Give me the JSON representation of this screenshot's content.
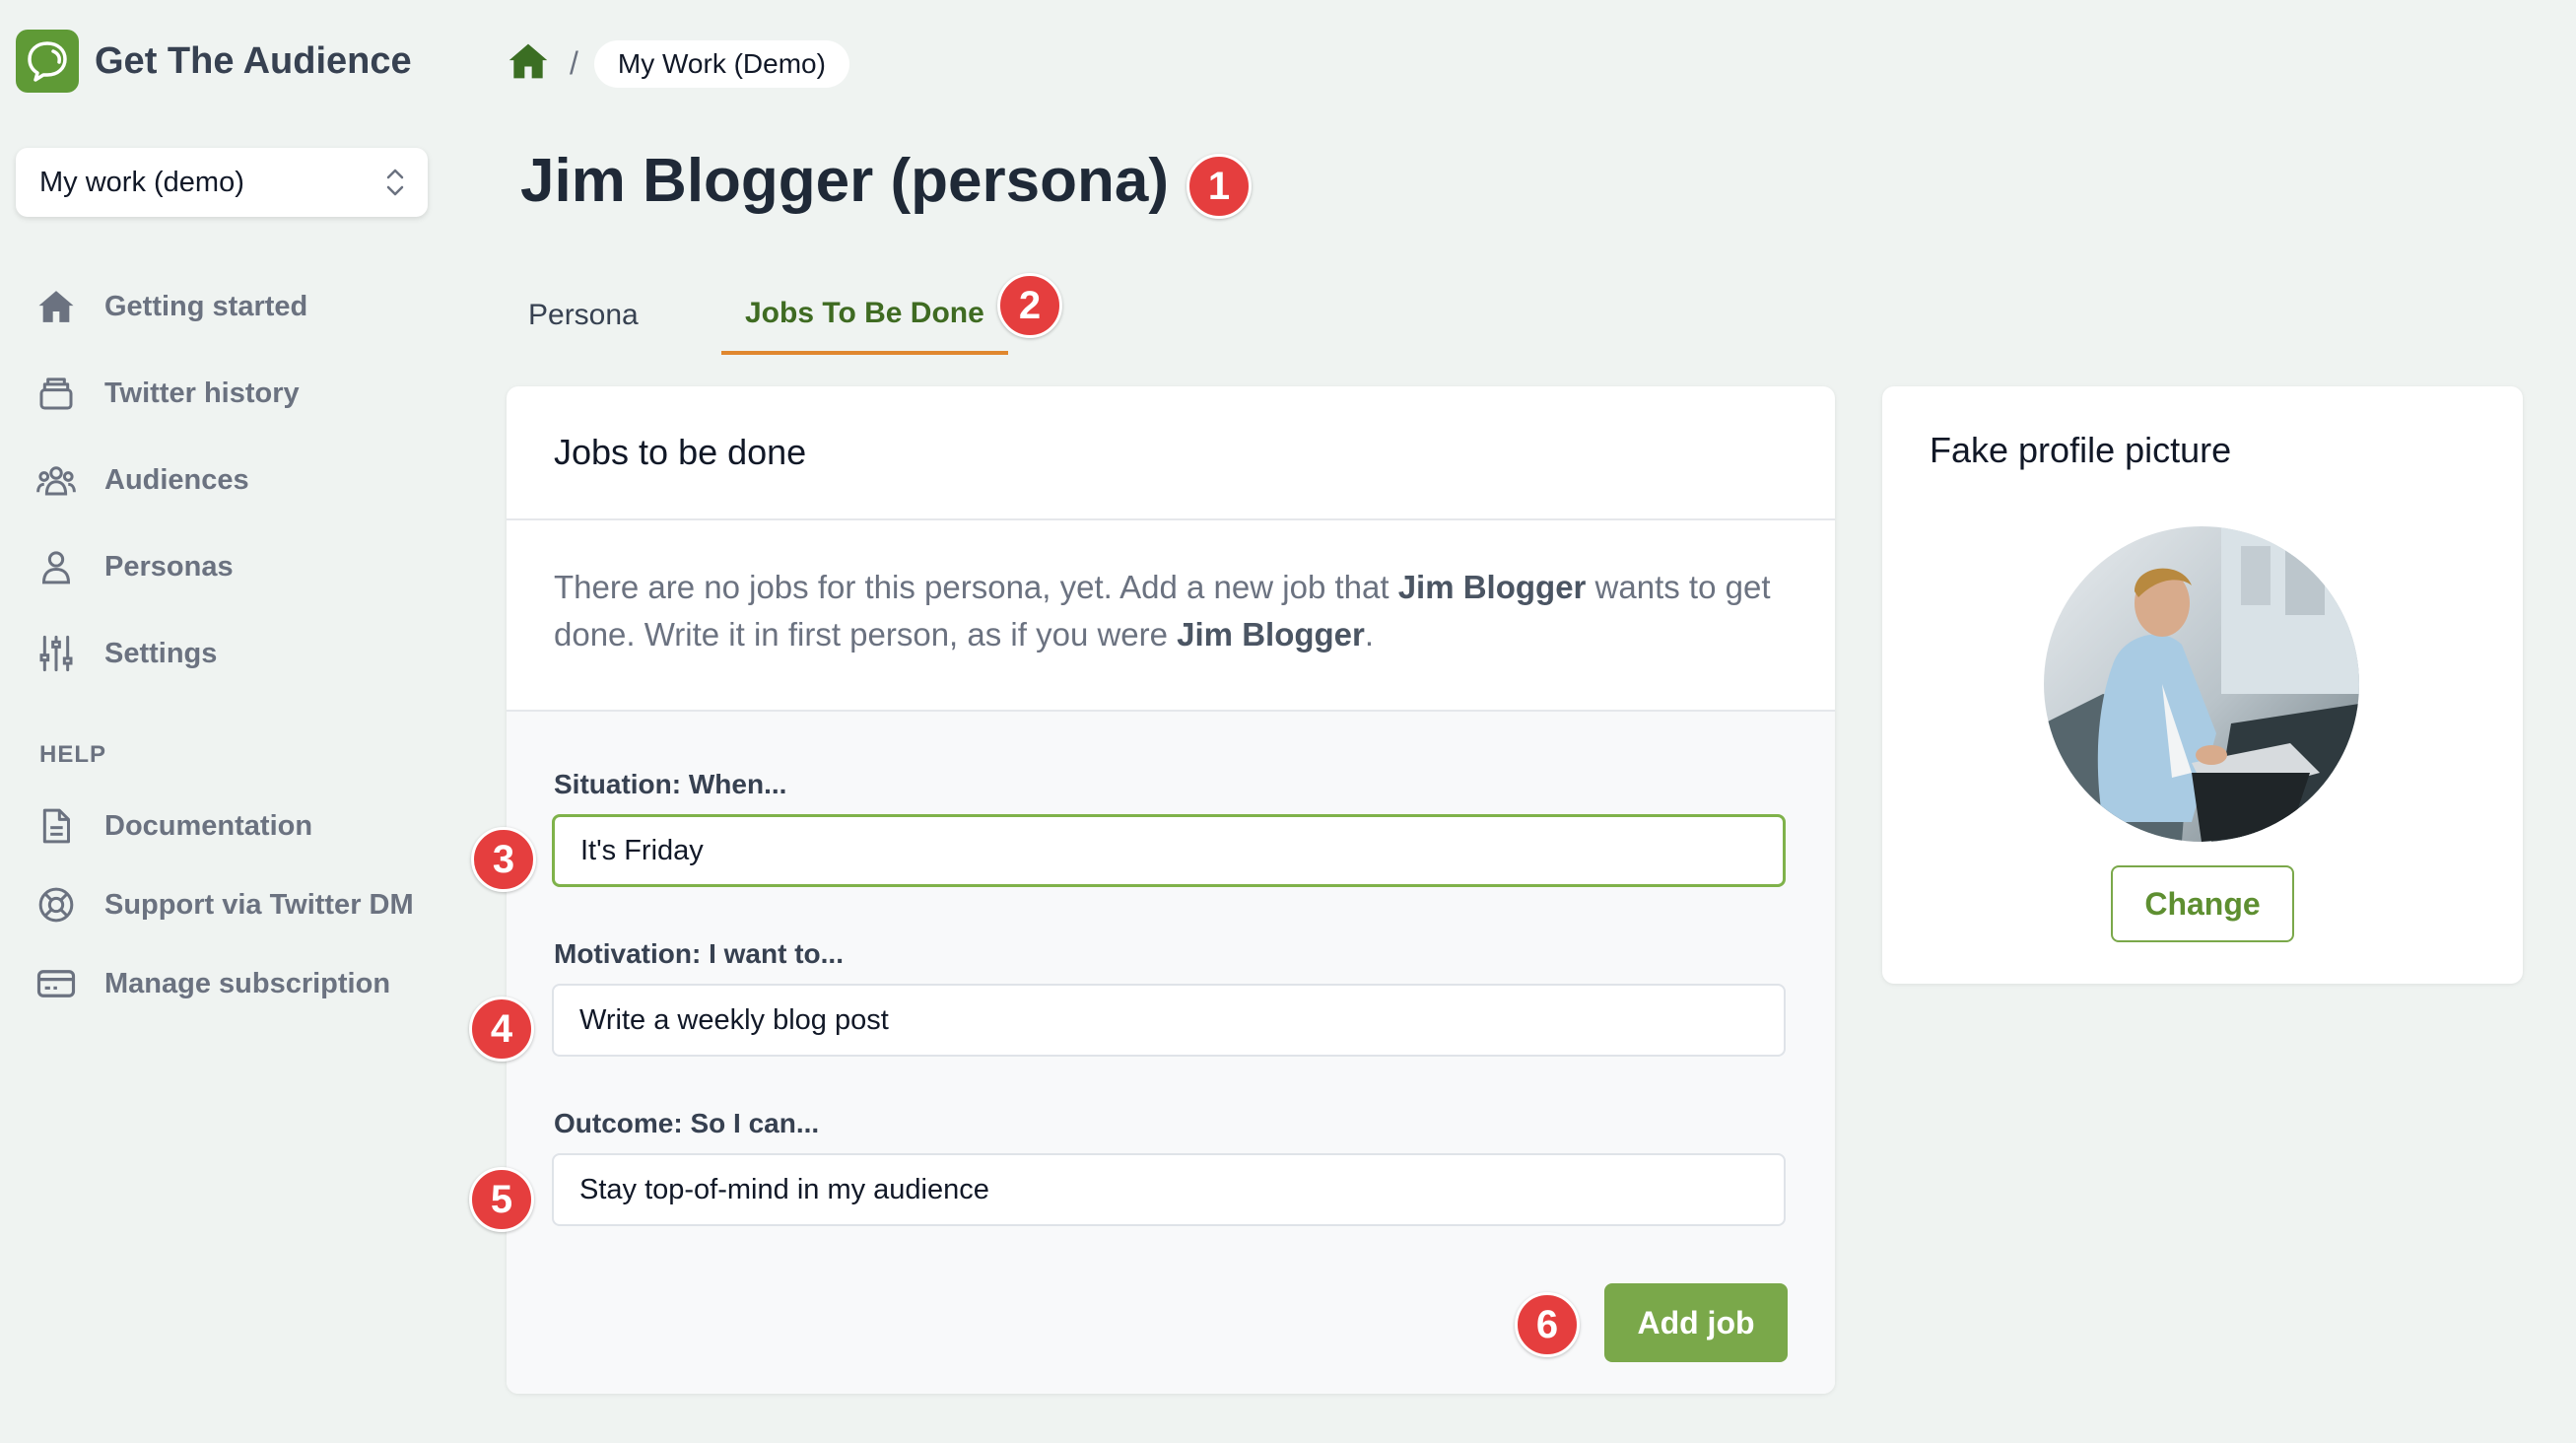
{
  "app": {
    "name": "Get The Audience",
    "brand_color": "#5f9a36"
  },
  "workspace": {
    "selected": "My work (demo)"
  },
  "sidebar": {
    "items": [
      {
        "label": "Getting started",
        "icon": "home-icon"
      },
      {
        "label": "Twitter history",
        "icon": "inbox-icon"
      },
      {
        "label": "Audiences",
        "icon": "user-group-icon"
      },
      {
        "label": "Personas",
        "icon": "user-icon"
      },
      {
        "label": "Settings",
        "icon": "sliders-icon"
      }
    ],
    "help_label": "HELP",
    "help_items": [
      {
        "label": "Documentation",
        "icon": "document-icon"
      },
      {
        "label": "Support via Twitter DM",
        "icon": "lifebuoy-icon"
      },
      {
        "label": "Manage subscription",
        "icon": "credit-card-icon"
      }
    ]
  },
  "breadcrumb": {
    "separator": "/",
    "current": "My Work (Demo)"
  },
  "page": {
    "title": "Jim Blogger (persona)"
  },
  "tabs": [
    {
      "label": "Persona",
      "active": false
    },
    {
      "label": "Jobs To Be Done",
      "active": true
    }
  ],
  "jobs_card": {
    "title": "Jobs to be done",
    "intro": {
      "part1": "There are no jobs for this persona, yet. Add a new job that ",
      "name1": "Jim Blogger",
      "part2": " wants to get done. Write it in first person, as if you were ",
      "name2": "Jim Blogger",
      "part3": "."
    },
    "situation": {
      "label": "Situation: When...",
      "value": "It's Friday"
    },
    "motivation": {
      "label": "Motivation: I want to...",
      "value": "Write a weekly blog post"
    },
    "outcome": {
      "label": "Outcome: So I can...",
      "value": "Stay top-of-mind in my audience"
    },
    "add_button": "Add job"
  },
  "profile_card": {
    "title": "Fake profile picture",
    "change_button": "Change"
  },
  "annotations": [
    "1",
    "2",
    "3",
    "4",
    "5",
    "6"
  ],
  "colors": {
    "accent_green": "#7aa84a",
    "tab_underline": "#e0872f",
    "badge_red": "#e53e3e"
  }
}
